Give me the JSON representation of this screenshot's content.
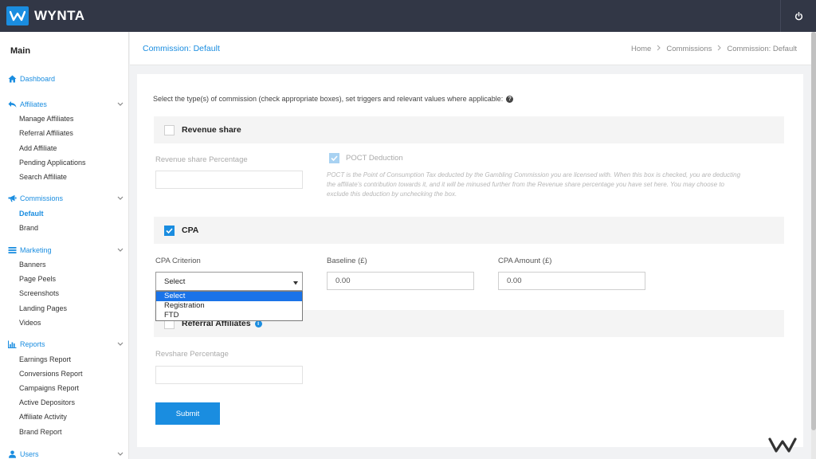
{
  "app": {
    "brand": "WYNTA"
  },
  "sidebar": {
    "title": "Main",
    "dashboard": "Dashboard",
    "affiliates": {
      "label": "Affiliates",
      "items": [
        "Manage Affiliates",
        "Referral Affiliates",
        "Add Affiliate",
        "Pending Applications",
        "Search Affiliate"
      ]
    },
    "commissions": {
      "label": "Commissions",
      "items": [
        "Default",
        "Brand"
      ],
      "active": "Default"
    },
    "marketing": {
      "label": "Marketing",
      "items": [
        "Banners",
        "Page Peels",
        "Screenshots",
        "Landing Pages",
        "Videos"
      ]
    },
    "reports": {
      "label": "Reports",
      "items": [
        "Earnings Report",
        "Conversions Report",
        "Campaigns Report",
        "Active Depositors",
        "Affiliate Activity",
        "Brand Report"
      ]
    },
    "users": {
      "label": "Users"
    }
  },
  "header": {
    "title": "Commission: Default",
    "breadcrumb": [
      "Home",
      "Commissions",
      "Commission: Default"
    ]
  },
  "form": {
    "intro": "Select the type(s) of commission (check appropriate boxes), set triggers and relevant values where applicable:",
    "revenue_share": {
      "label": "Revenue share",
      "checked": false,
      "percentage_label": "Revenue share Percentage",
      "percentage_value": "",
      "poct_label": "POCT Deduction",
      "poct_checked": true,
      "poct_note": "POCT is the Point of Consumption Tax deducted by the Gambling Commission you are licensed with. When this box is checked, you are deducting the affiliate's contribution towards it, and it will be minused further from the Revenue share percentage you have set here. You may choose to exclude this deduction by unchecking the box."
    },
    "cpa": {
      "label": "CPA",
      "checked": true,
      "criterion_label": "CPA Criterion",
      "criterion_value": "Select",
      "criterion_options": [
        "Select",
        "Registration",
        "FTD"
      ],
      "baseline_label": "Baseline (£)",
      "baseline_value": "0.00",
      "amount_label": "CPA Amount (£)",
      "amount_value": "0.00"
    },
    "referral": {
      "label": "Referral Affiliates",
      "checked": false,
      "percentage_label": "Revshare Percentage",
      "percentage_value": ""
    },
    "submit_label": "Submit"
  },
  "colors": {
    "accent": "#1a8de0",
    "topbar": "#323746"
  }
}
